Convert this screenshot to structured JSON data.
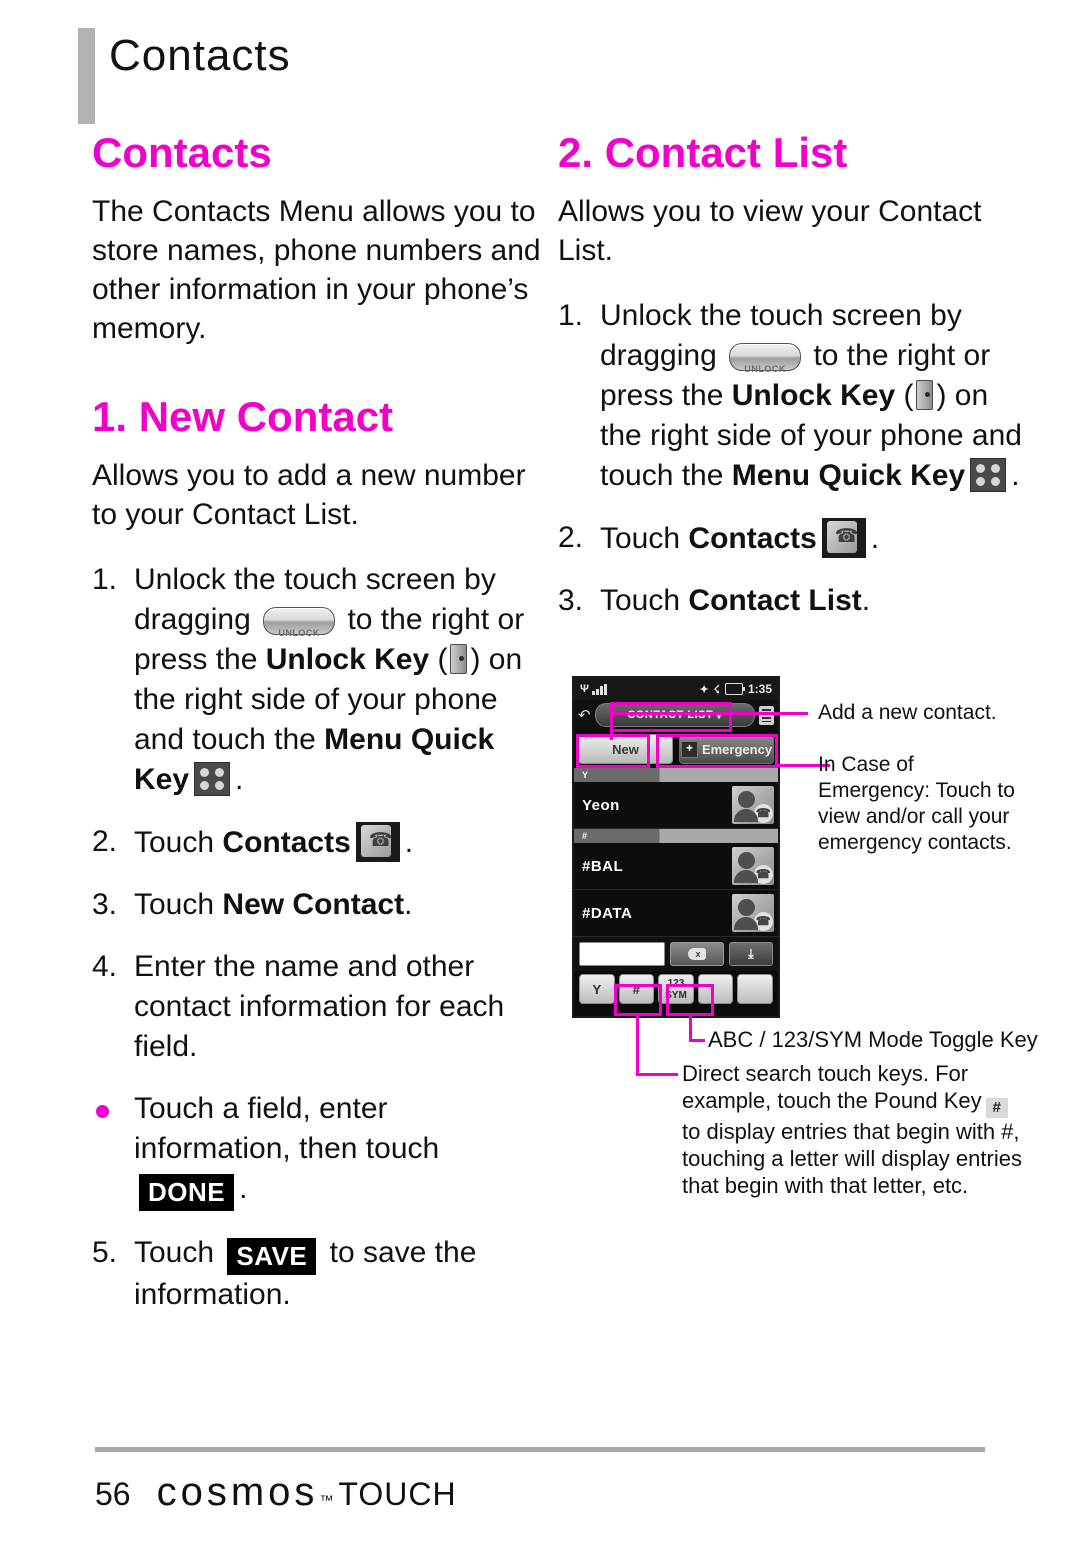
{
  "running_head": {
    "title": "Contacts"
  },
  "left_column": {
    "heading": "Contacts",
    "intro": "The Contacts Menu allows you to store names, phone numbers and other information in your phone’s memory.",
    "section": {
      "heading": "1. New Contact",
      "description": "Allows you to add a new number to your Contact List.",
      "steps": {
        "s1_num": "1.",
        "s1_a": "Unlock the touch screen by dragging",
        "s1_b": "to the right or press the",
        "s1_bold1": "Unlock Key",
        "s1_c": "(",
        "s1_d": ") on the right side of your phone and touch the",
        "s1_bold2": "Menu Quick Key",
        "s1_e": ".",
        "s2_num": "2.",
        "s2_a": "Touch",
        "s2_bold": "Contacts",
        "s2_b": ".",
        "s3_num": "3.",
        "s3_a": "Touch",
        "s3_bold": "New Contact",
        "s3_b": ".",
        "s4_num": "4.",
        "s4_a": "Enter the name and other contact information for each field.",
        "bullet_a": "Touch a field, enter information, then touch",
        "bullet_key": "DONE",
        "bullet_b": ".",
        "s5_num": "5.",
        "s5_a": "Touch",
        "s5_key": "SAVE",
        "s5_b": "to save the information."
      }
    }
  },
  "right_column": {
    "section": {
      "heading": "2. Contact List",
      "description": "Allows you to view your Contact List.",
      "steps": {
        "s1_num": "1.",
        "s1_a": "Unlock the touch screen by dragging",
        "s1_b": "to the right or press the",
        "s1_bold1": "Unlock Key",
        "s1_c": "(",
        "s1_d": ") on the right side of your phone and touch the",
        "s1_bold2": "Menu Quick Key",
        "s1_e": ".",
        "s2_num": "2.",
        "s2_a": "Touch",
        "s2_bold": "Contacts",
        "s2_b": ".",
        "s3_num": "3.",
        "s3_a": "Touch",
        "s3_bold": "Contact List",
        "s3_b": "."
      }
    }
  },
  "figure": {
    "phone": {
      "status": {
        "clock": "1:35"
      },
      "title_bar": {
        "title": "CONTACT LIST",
        "caret": "▾"
      },
      "buttons": {
        "new": "New",
        "emergency": "Emergency",
        "plus": "+"
      },
      "groups": {
        "g1": "Y",
        "g2": "#"
      },
      "contacts": [
        {
          "name": "Yeon"
        },
        {
          "name": "#BAL"
        },
        {
          "name": "#DATA"
        }
      ],
      "search": {
        "value": "",
        "delete_label": "x",
        "down_label": "⤓"
      },
      "keys": [
        {
          "label": "Y"
        },
        {
          "label": "#"
        },
        {
          "label_top": "123",
          "label_bottom": "SYM"
        },
        {
          "label": ""
        },
        {
          "label": ""
        }
      ]
    },
    "callouts": {
      "add_new": "Add a new contact.",
      "emergency": "In Case of Emergency: Touch to view and/or call your emergency contacts.",
      "toggle": "ABC / 123/SYM Mode Toggle Key",
      "direct_a": "Direct search touch keys. For example, touch the Pound Key",
      "direct_key": "#",
      "direct_b": "to display entries that begin with #, touching a letter will display entries that begin with that letter, etc."
    }
  },
  "footer": {
    "page_number": "56",
    "brand": "cosmos",
    "trademark": "™",
    "brand_suffix": "TOUCH"
  },
  "colors": {
    "accent": "#f000c8",
    "rule": "#a9a9a9",
    "text": "#111111"
  }
}
